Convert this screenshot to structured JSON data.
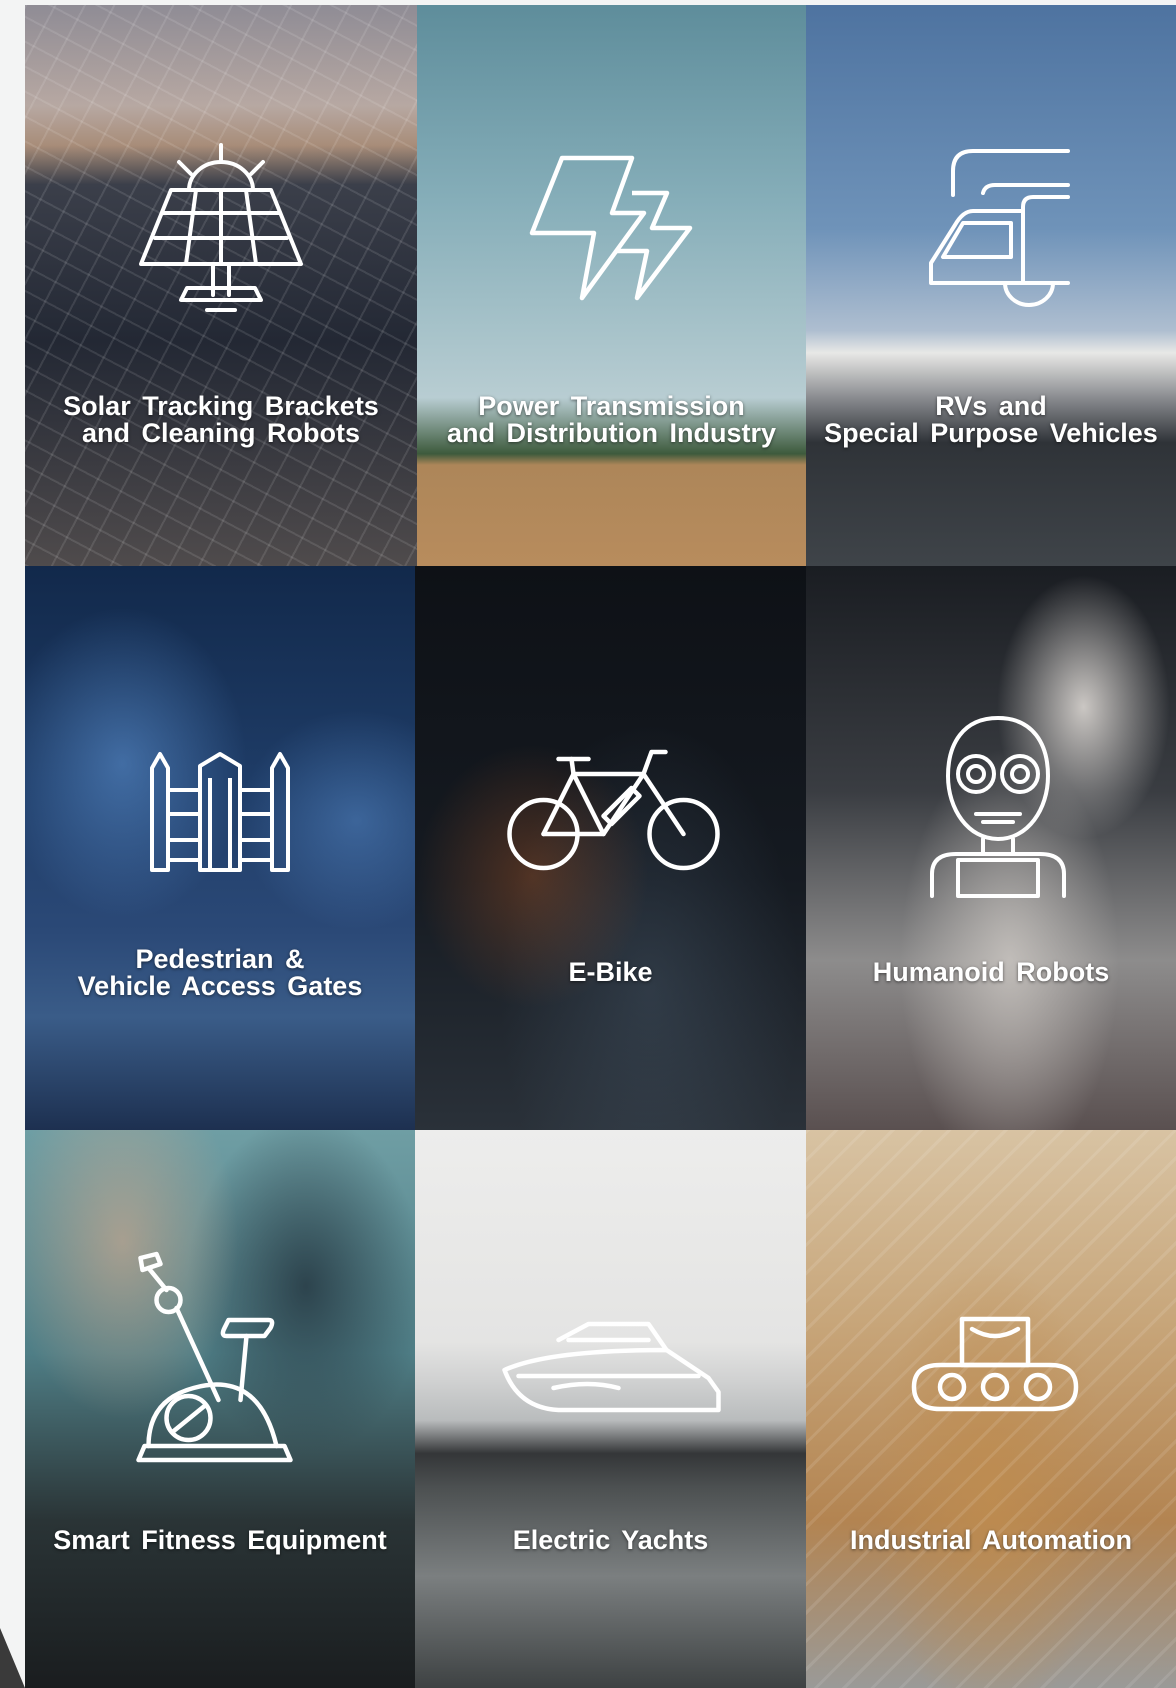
{
  "tiles": [
    {
      "id": "solar",
      "label": "Solar  Tracking  Brackets\nand Cleaning  Robots",
      "icon": "solar-panel-icon"
    },
    {
      "id": "power",
      "label": "Power  Transmission\nand  Distribution  Industry",
      "icon": "lightning-bolt-icon"
    },
    {
      "id": "rv",
      "label": "RVs  and\nSpecial  Purpose  Vehicles",
      "icon": "rv-vehicle-icon"
    },
    {
      "id": "gate",
      "label": "Pedestrian &\nVehicle  Access  Gates",
      "icon": "fence-gate-icon"
    },
    {
      "id": "ebike",
      "label": "E-Bike",
      "icon": "bicycle-icon"
    },
    {
      "id": "humanoid",
      "label": "Humanoid  Robots",
      "icon": "robot-head-icon"
    },
    {
      "id": "fitness",
      "label": "Smart  Fitness  Equipment",
      "icon": "exercise-bike-icon"
    },
    {
      "id": "yacht",
      "label": "Electric  Yachts",
      "icon": "yacht-icon"
    },
    {
      "id": "auto",
      "label": "Industrial  Automation",
      "icon": "conveyor-robot-icon"
    }
  ]
}
